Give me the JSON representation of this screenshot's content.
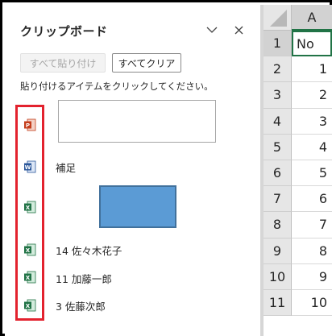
{
  "clipboard": {
    "title": "クリップボード",
    "paste_all_label": "すべて貼り付け",
    "clear_all_label": "すべてクリア",
    "hint": "貼り付けるアイテムをクリックしてください。",
    "items": [
      {
        "app": "powerpoint",
        "icon": "powerpoint-icon",
        "text": ""
      },
      {
        "app": "word",
        "icon": "word-icon",
        "text": "補足"
      },
      {
        "app": "excel",
        "icon": "excel-icon",
        "text": ""
      },
      {
        "app": "excel",
        "icon": "excel-icon",
        "text": "14 佐々木花子"
      },
      {
        "app": "excel",
        "icon": "excel-icon",
        "text": "11 加藤一郎"
      },
      {
        "app": "excel",
        "icon": "excel-icon",
        "text": "3 佐藤次郎"
      }
    ],
    "highlight_color": "#e3222e"
  },
  "sheet": {
    "column": "A",
    "rows": [
      {
        "num": "1",
        "value": "No"
      },
      {
        "num": "2",
        "value": "1"
      },
      {
        "num": "3",
        "value": "2"
      },
      {
        "num": "4",
        "value": "3"
      },
      {
        "num": "5",
        "value": "4"
      },
      {
        "num": "6",
        "value": "5"
      },
      {
        "num": "7",
        "value": "6"
      },
      {
        "num": "8",
        "value": "7"
      },
      {
        "num": "9",
        "value": "8"
      },
      {
        "num": "10",
        "value": "9"
      },
      {
        "num": "11",
        "value": "10"
      }
    ],
    "accent": "#217346"
  }
}
